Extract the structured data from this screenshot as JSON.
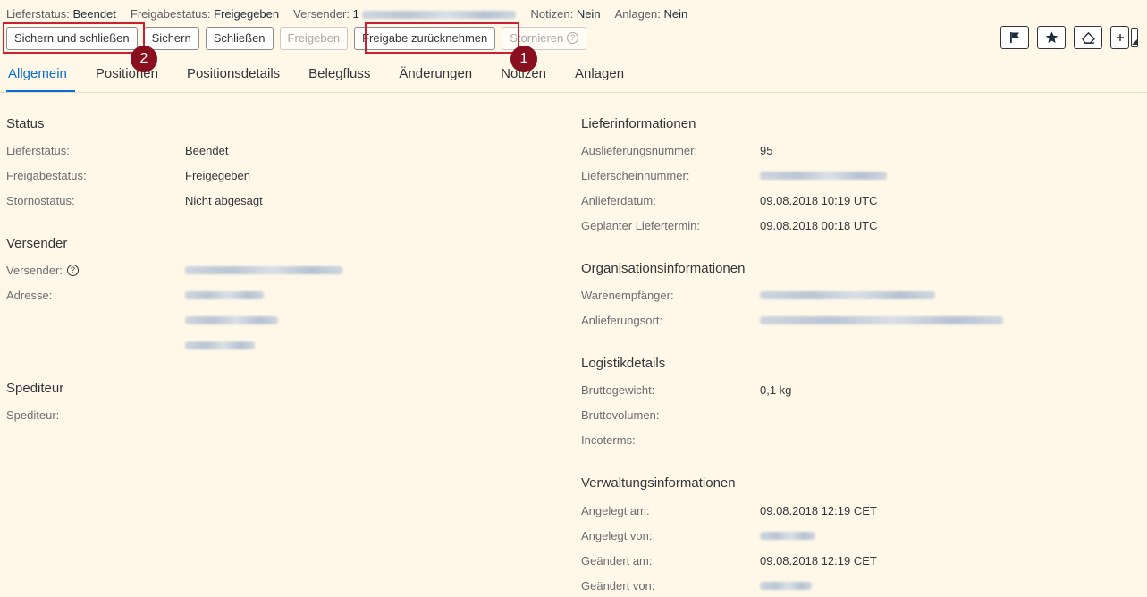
{
  "statusbar": {
    "items": [
      {
        "key": "Lieferstatus:",
        "value": "Beendet"
      },
      {
        "key": "Freigabestatus:",
        "value": "Freigegeben"
      },
      {
        "key": "Versender:",
        "value": "1"
      },
      {
        "key": "Notizen:",
        "value": "Nein"
      },
      {
        "key": "Anlagen:",
        "value": "Nein"
      }
    ]
  },
  "toolbar": {
    "save_close": "Sichern und schließen",
    "save": "Sichern",
    "close": "Schließen",
    "release": "Freigeben",
    "revoke_release": "Freigabe zurücknehmen",
    "cancel": "Stornieren",
    "help_glyph": "?"
  },
  "callouts": {
    "one": "1",
    "two": "2"
  },
  "icons": [
    "flag-icon",
    "star-icon",
    "eraser-icon",
    "add-icon"
  ],
  "tabs": [
    "Allgemein",
    "Positionen",
    "Positionsdetails",
    "Belegfluss",
    "Änderungen",
    "Notizen",
    "Anlagen"
  ],
  "left": {
    "status_title": "Status",
    "status": [
      {
        "label": "Lieferstatus:",
        "value": "Beendet"
      },
      {
        "label": "Freigabestatus:",
        "value": "Freigegeben"
      },
      {
        "label": "Stornostatus:",
        "value": "Nicht abgesagt"
      }
    ],
    "sender_title": "Versender",
    "sender_label": "Versender:",
    "address_label": "Adresse:",
    "carrier_title": "Spediteur",
    "carrier_label": "Spediteur:"
  },
  "right": {
    "delivery_title": "Lieferinformationen",
    "delivery": [
      {
        "label": "Auslieferungsnummer:",
        "value": "95"
      },
      {
        "label": "Lieferscheinnummer:",
        "value": ""
      },
      {
        "label": "Anlieferdatum:",
        "value": "09.08.2018 10:19 UTC"
      },
      {
        "label": "Geplanter Liefertermin:",
        "value": "09.08.2018 00:18 UTC"
      }
    ],
    "org_title": "Organisationsinformationen",
    "org": [
      {
        "label": "Warenempfänger:",
        "value": ""
      },
      {
        "label": "Anlieferungsort:",
        "value": ""
      }
    ],
    "logistics_title": "Logistikdetails",
    "logistics": [
      {
        "label": "Bruttogewicht:",
        "value": "0,1 kg"
      },
      {
        "label": "Bruttovolumen:",
        "value": ""
      },
      {
        "label": "Incoterms:",
        "value": ""
      }
    ],
    "admin_title": "Verwaltungsinformationen",
    "admin": [
      {
        "label": "Angelegt am:",
        "value": "09.08.2018 12:19 CET"
      },
      {
        "label": "Angelegt von:",
        "value": ""
      },
      {
        "label": "Geändert am:",
        "value": "09.08.2018 12:19 CET"
      },
      {
        "label": "Geändert von:",
        "value": ""
      }
    ]
  }
}
